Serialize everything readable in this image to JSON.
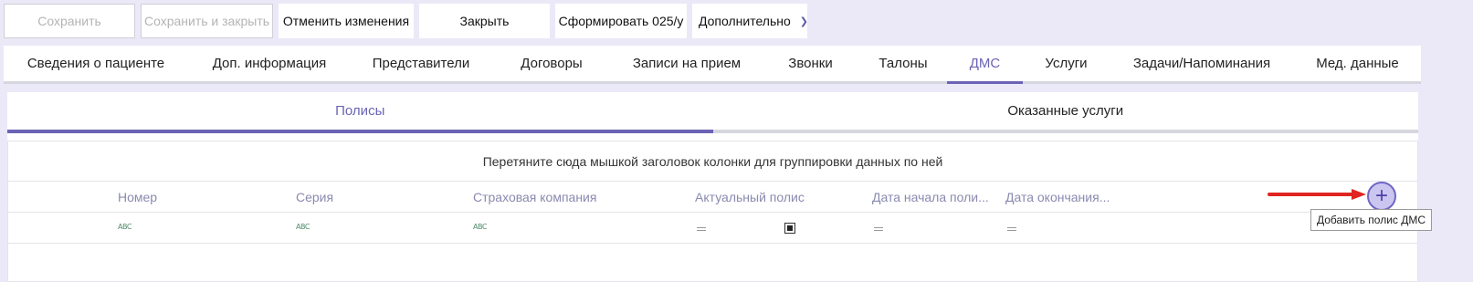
{
  "toolbar": {
    "save": "Сохранить",
    "save_close": "Сохранить и закрыть",
    "cancel_changes": "Отменить изменения",
    "close": "Закрыть",
    "form_025": "Сформировать 025/у",
    "more": "Дополнительно"
  },
  "main_tabs": [
    {
      "label": "Сведения о пациенте"
    },
    {
      "label": "Доп. информация"
    },
    {
      "label": "Представители"
    },
    {
      "label": "Договоры"
    },
    {
      "label": "Записи на прием"
    },
    {
      "label": "Звонки"
    },
    {
      "label": "Талоны"
    },
    {
      "label": "ДМС",
      "active": true
    },
    {
      "label": "Услуги"
    },
    {
      "label": "Задачи/Напоминания"
    },
    {
      "label": "Мед. данные"
    }
  ],
  "sub_tabs": [
    {
      "label": "Полисы",
      "active": true
    },
    {
      "label": "Оказанные услуги"
    }
  ],
  "grid": {
    "group_hint": "Перетяните сюда мышкой заголовок колонки для группировки данных по ней",
    "columns": [
      "Номер",
      "Серия",
      "Страховая компания",
      "Актуальный полис",
      "Дата начала поли...",
      "Дата окончания..."
    ],
    "filter_icon_text": "ABC"
  },
  "add_button": {
    "symbol": "+",
    "tooltip": "Добавить полис ДМС"
  },
  "colors": {
    "accent": "#6b63b5",
    "background": "#ebe9f7",
    "arrow": "#e0251f"
  }
}
